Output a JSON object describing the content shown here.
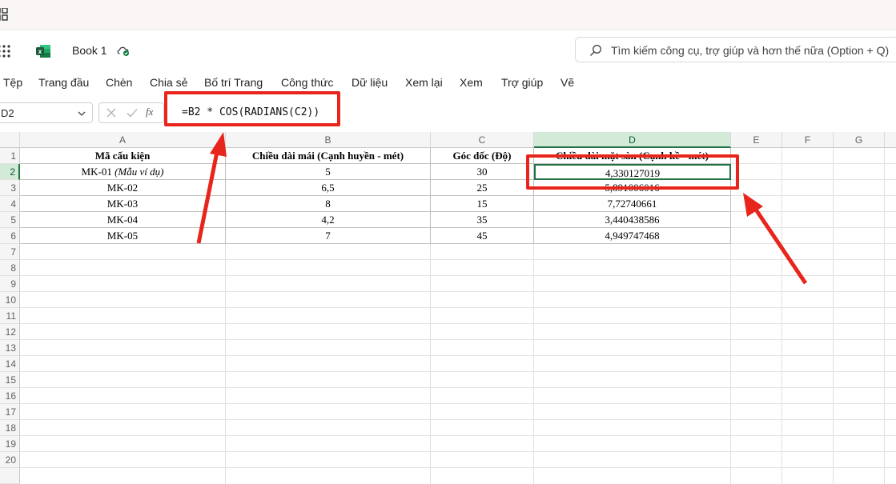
{
  "app": {
    "title": "Book 1",
    "search_placeholder": "Tìm kiếm công cụ, trợ giúp và hơn thế nữa (Option + Q)"
  },
  "ribbon": {
    "tabs": [
      "Tệp",
      "Trang đầu",
      "Chèn",
      "Chia sẻ",
      "Bố trí Trang",
      "Công thức",
      "Dữ liệu",
      "Xem lại",
      "Xem",
      "Trợ giúp",
      "Vẽ"
    ]
  },
  "formula_bar": {
    "name_box": "D2",
    "fx_label": "fx",
    "formula": "=B2 * COS(RADIANS(C2))"
  },
  "sheet": {
    "columns": [
      "A",
      "B",
      "C",
      "D",
      "E",
      "F",
      "G"
    ],
    "selected_column": "D",
    "selected_row": 2,
    "rows": [
      "1",
      "2",
      "3",
      "4",
      "5",
      "6",
      "7",
      "8",
      "9",
      "10",
      "11",
      "12",
      "13",
      "14",
      "15",
      "16",
      "17",
      "18",
      "19",
      "20"
    ],
    "header": [
      "Mã cấu kiện",
      "Chiều dài mái (Cạnh huyền - mét)",
      "Góc dốc (Độ)",
      "Chiều dài mặt sàn (Cạnh kề - mét)"
    ],
    "data": [
      {
        "a": "MK-01 ",
        "a_note": "(Mẫu ví dụ)",
        "b": "5",
        "c": "30",
        "d": "4,330127019"
      },
      {
        "a": "MK-02",
        "a_note": "",
        "b": "6,5",
        "c": "25",
        "d": "5,891006016"
      },
      {
        "a": "MK-03",
        "a_note": "",
        "b": "8",
        "c": "15",
        "d": "7,72740661"
      },
      {
        "a": "MK-04",
        "a_note": "",
        "b": "4,2",
        "c": "35",
        "d": "3,440438586"
      },
      {
        "a": "MK-05",
        "a_note": "",
        "b": "7",
        "c": "45",
        "d": "4,949747468"
      }
    ]
  },
  "colors": {
    "annotation_red": "#e8251c",
    "excel_green": "#217346",
    "selected_header_bg": "#d3ead9"
  }
}
